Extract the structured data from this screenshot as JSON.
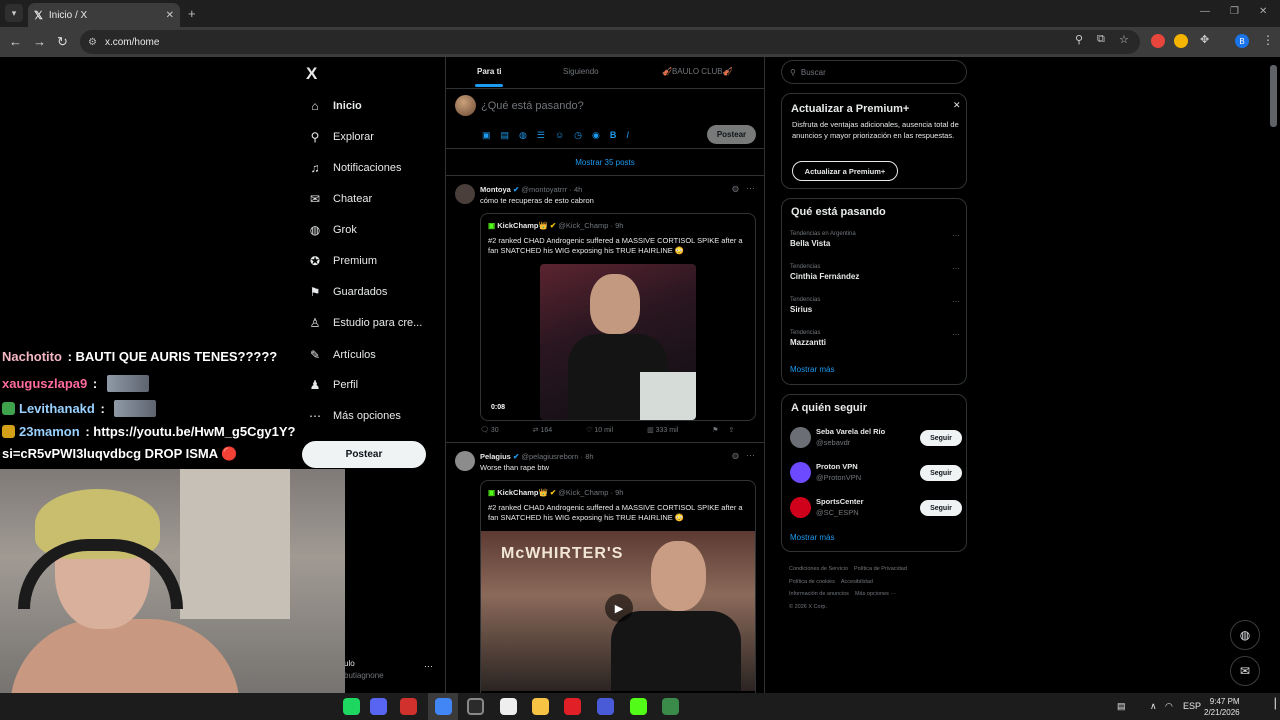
{
  "browser": {
    "tab_title": "Inicio / X",
    "tab_close": "✕",
    "new_tab": "+",
    "url": "x.com/home",
    "profile_initial": "B"
  },
  "nav": {
    "brand": "X",
    "items": [
      {
        "label": "Inicio",
        "icon": "home-icon",
        "glyph": "⌂"
      },
      {
        "label": "Explorar",
        "icon": "search-icon",
        "glyph": "⚲"
      },
      {
        "label": "Notificaciones",
        "icon": "bell-icon",
        "glyph": "♫"
      },
      {
        "label": "Chatear",
        "icon": "mail-icon",
        "glyph": "✉"
      },
      {
        "label": "Grok",
        "icon": "grok-icon",
        "glyph": "◍"
      },
      {
        "label": "Premium",
        "icon": "premium-icon",
        "glyph": "✪"
      },
      {
        "label": "Guardados",
        "icon": "bookmark-icon",
        "glyph": "⚑"
      },
      {
        "label": "Estudio para cre...",
        "icon": "studio-icon",
        "glyph": "♙"
      },
      {
        "label": "Artículos",
        "icon": "article-icon",
        "glyph": "✎"
      },
      {
        "label": "Perfil",
        "icon": "profile-icon",
        "glyph": "♟"
      },
      {
        "label": "Más opciones",
        "icon": "more-icon",
        "glyph": "⋯"
      }
    ],
    "post_button": "Postear",
    "account_name": "ulo",
    "account_handle": "butiagnone",
    "account_more": "···"
  },
  "timeline": {
    "tabs": [
      "Para ti",
      "Siguiendo",
      "🎻BAULO CLUB🎻"
    ],
    "composer_placeholder": "¿Qué está pasando?",
    "composer_post": "Postear",
    "show_more": "Mostrar 35 posts",
    "posts": [
      {
        "name": "Montoya",
        "meta": "@montoyatrrr · 4h",
        "text": "cómo te recuperas de esto cabron",
        "quote_name": "KickChamp👑",
        "quote_meta": "@Kick_Champ · 9h",
        "quote_text": "#2 ranked CHAD Androgenic suffered a MASSIVE CORTISOL SPIKE after a fan SNATCHED his WIG exposing his TRUE HAIRLINE 😳",
        "timecode": "0:08",
        "replies": "30",
        "reposts": "164",
        "likes": "10 mil",
        "views": "333 mil"
      },
      {
        "name": "Pelagius",
        "meta": "@pelagiusreborn · 8h",
        "text": "Worse than rape btw",
        "quote_name": "KickChamp👑",
        "quote_meta": "@Kick_Champ · 9h",
        "quote_text": "#2 ranked CHAD Androgenic suffered a MASSIVE CORTISOL SPIKE after a fan SNATCHED his WIG exposing his TRUE HAIRLINE 😳",
        "sign": "McWHIRTER'S"
      }
    ]
  },
  "sidebar": {
    "search_placeholder": "Buscar",
    "premium": {
      "title": "Actualizar a Premium+",
      "desc": "Disfruta de ventajas adicionales, ausencia total de anuncios y mayor priorización en las respuestas.",
      "button": "Actualizar a Premium+"
    },
    "trends_title": "Qué está pasando",
    "trends": [
      {
        "context": "Tendencias en Argentina",
        "name": "Bella Vista"
      },
      {
        "context": "Tendencias",
        "name": "Cinthia Fernández"
      },
      {
        "context": "Tendencias",
        "name": "Sirius"
      },
      {
        "context": "Tendencias",
        "name": "Mazzantti"
      }
    ],
    "show_more": "Mostrar más",
    "follow_title": "A quién seguir",
    "follow": [
      {
        "name": "Seba Varela del Río",
        "handle": "@sebavdr",
        "button": "Seguir",
        "color": "#6b6f75"
      },
      {
        "name": "Proton VPN",
        "handle": "@ProtonVPN",
        "button": "Seguir",
        "color": "#6d4aff"
      },
      {
        "name": "SportsCenter",
        "handle": "@SC_ESPN",
        "button": "Seguir",
        "color": "#d0021b"
      }
    ],
    "follow_more": "Mostrar más",
    "footer": [
      "Condiciones de Servicio",
      "Política de Privacidad",
      "Política de cookies",
      "Accesibilidad",
      "Información de anuncios",
      "Más opciones ···",
      "© 2026 X Corp."
    ]
  },
  "chat": [
    {
      "user": "Nachotito",
      "message": "BAUTI QUE AURIS TENES?????",
      "color": "#f4b6c2"
    },
    {
      "user": "xauguszlapa9",
      "message": "",
      "color": "#ff6b9d"
    },
    {
      "user": "Levithanakd",
      "message": "",
      "color": "#9ad1ff"
    },
    {
      "user": "23mamon",
      "message": "https://youtu.be/HwM_g5Cgy1Y?",
      "color": "#9ad1ff"
    },
    {
      "user": "",
      "message": "si=cR5vPWI3luqvdbcg DROP ISMA 🔴",
      "color": "#ffffff"
    }
  ],
  "taskbar": {
    "lang": "ESP",
    "time": "9:47 PM",
    "date": "2/21/2026"
  }
}
